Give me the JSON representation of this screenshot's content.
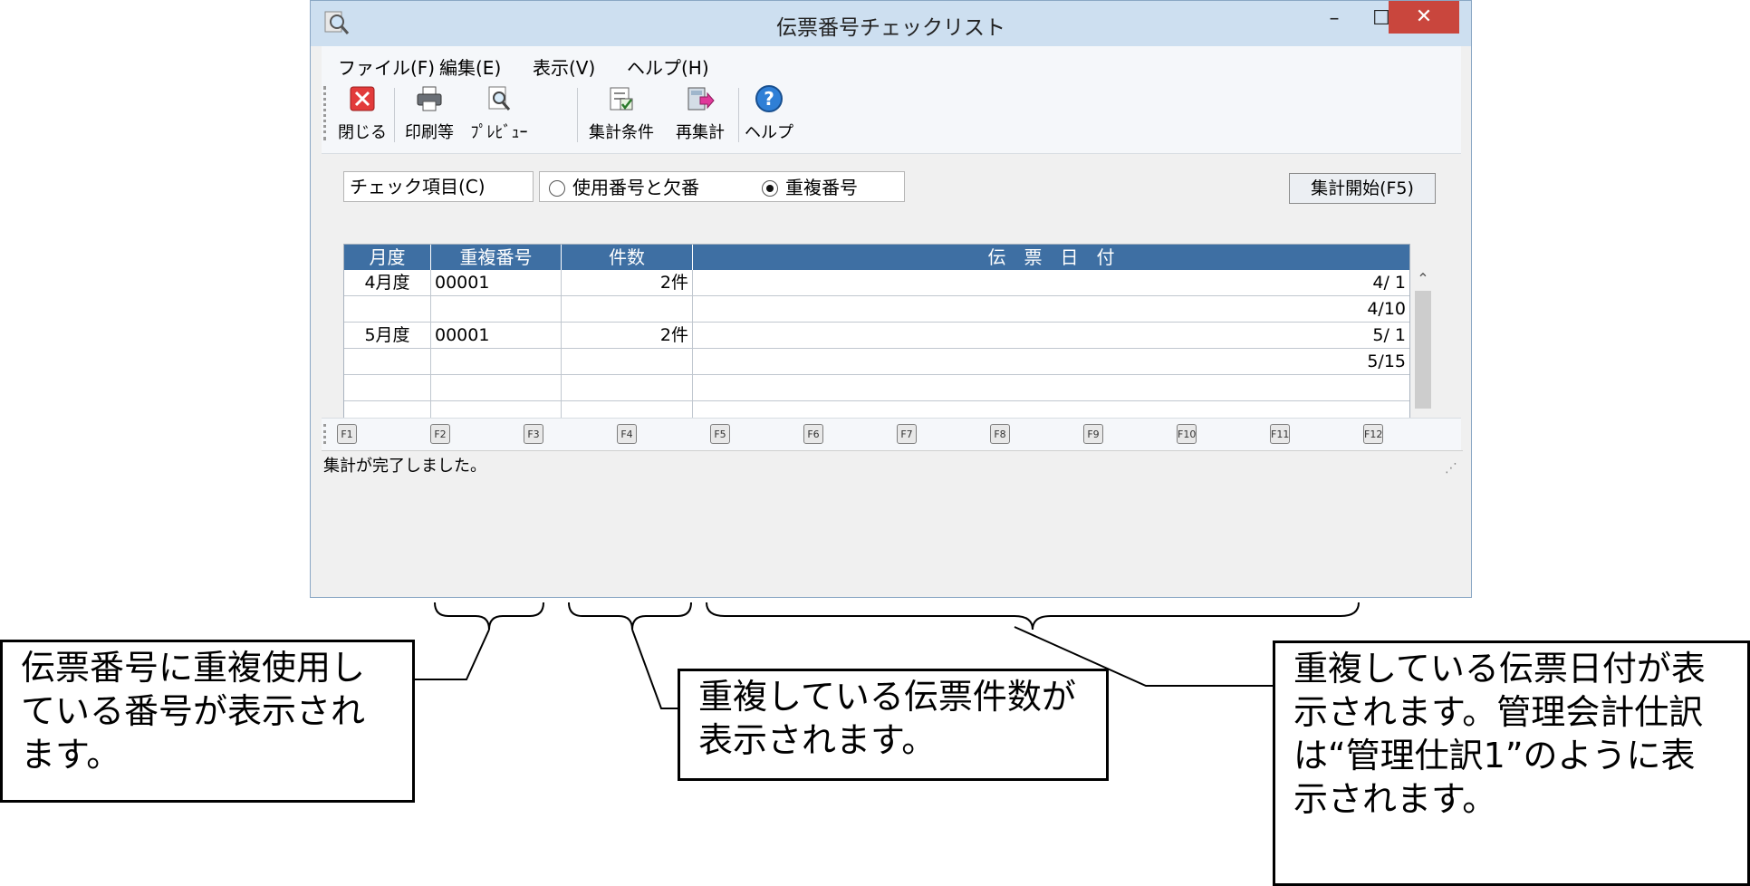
{
  "window": {
    "title": "伝票番号チェックリスト",
    "min_glyph": "–",
    "max_glyph": "☐",
    "close_glyph": "✕"
  },
  "menu": [
    "ファイル(F)",
    "編集(E)",
    "表示(V)",
    "ヘルプ(H)"
  ],
  "toolbar": [
    {
      "label": "閉じる",
      "icon": "close-x-icon"
    },
    {
      "label": "印刷等",
      "icon": "printer-icon"
    },
    {
      "label": "ﾌﾟﾚﾋﾞｭｰ",
      "icon": "preview-magnifier-icon"
    },
    {
      "label": "集計条件",
      "icon": "checklist-icon"
    },
    {
      "label": "再集計",
      "icon": "recalc-icon"
    },
    {
      "label": "ヘルプ",
      "icon": "help-icon"
    }
  ],
  "check_item": {
    "label": "チェック項目(C)",
    "options": [
      {
        "label": "使用番号と欠番",
        "selected": false
      },
      {
        "label": "重複番号",
        "selected": true
      }
    ]
  },
  "start_button": "集計開始(F5)",
  "table": {
    "headers": [
      "月度",
      "重複番号",
      "件数",
      "伝　票　日　付"
    ],
    "rows": [
      [
        "4月度",
        "00001",
        "2件",
        "4/ 1"
      ],
      [
        "",
        "",
        "",
        "4/10"
      ],
      [
        "5月度",
        "00001",
        "2件",
        "5/ 1"
      ],
      [
        "",
        "",
        "",
        "5/15"
      ],
      [
        "",
        "",
        "",
        ""
      ],
      [
        "",
        "",
        "",
        ""
      ]
    ]
  },
  "fkeys": [
    "F1",
    "F2",
    "F3",
    "F4",
    "F5",
    "F6",
    "F7",
    "F8",
    "F9",
    "F10",
    "F11",
    "F12"
  ],
  "status": "集計が完了しました。",
  "annotations": {
    "left": "伝票番号に重複使用している番号が表示されます。",
    "middle": "重複している伝票件数が表示されます。",
    "right": "重複している伝票日付が表示されます。管理会計仕訳は“管理仕訳1”のように表示されます。"
  }
}
